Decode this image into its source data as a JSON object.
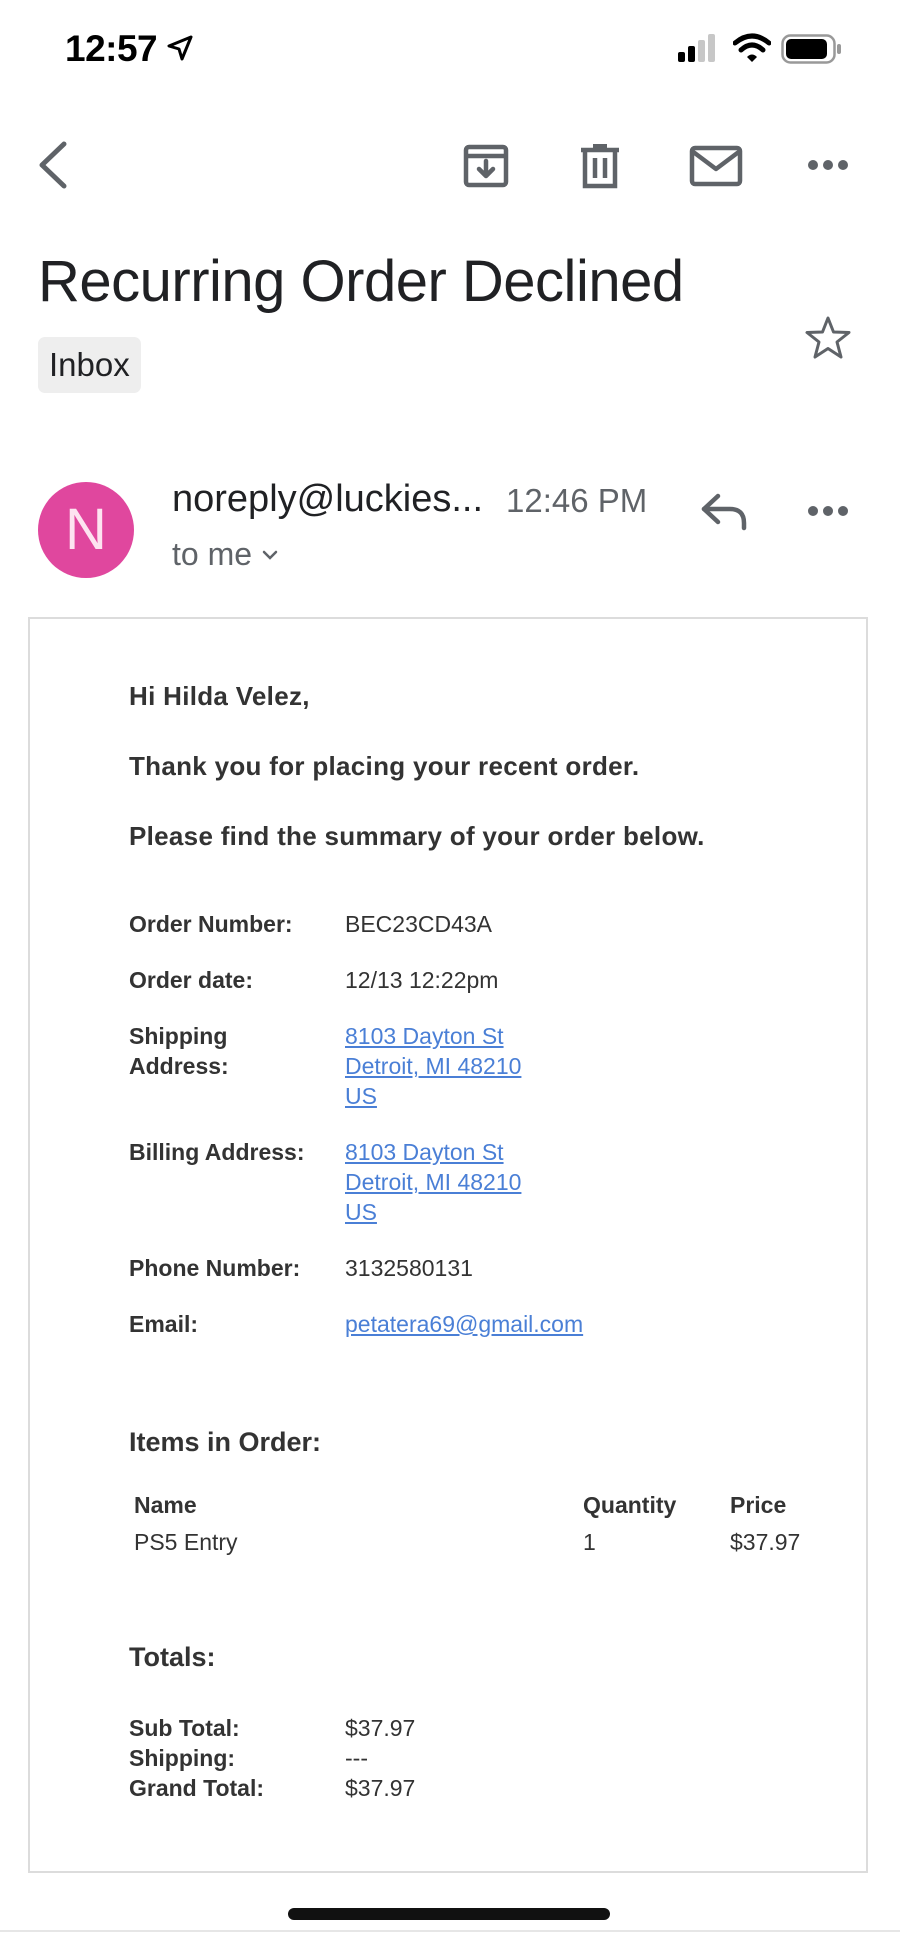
{
  "status_bar": {
    "time": "12:57"
  },
  "email": {
    "subject": "Recurring Order Declined",
    "label": "Inbox",
    "sender_initial": "N",
    "sender": "noreply@luckies...",
    "time": "12:46 PM",
    "recipient": "to me",
    "avatar_color": "#e0479e"
  },
  "body": {
    "greeting": "Hi Hilda Velez,",
    "line1": "Thank you for placing your recent order.",
    "line2": "Please find the summary of your order below.",
    "order_number_label": "Order Number:",
    "order_number": "BEC23CD43A",
    "order_date_label": "Order date:",
    "order_date": "12/13 12:22pm",
    "shipping_label_1": "Shipping",
    "shipping_label_2": "Address:",
    "shipping_address": [
      "8103 Dayton St",
      "Detroit, MI 48210",
      "US"
    ],
    "billing_label": "Billing Address:",
    "billing_address": [
      "8103 Dayton St",
      "Detroit, MI 48210",
      "US"
    ],
    "phone_label": "Phone Number:",
    "phone": "3132580131",
    "email_label": "Email:",
    "email": "petatera69@gmail.com",
    "items_title": "Items in Order:",
    "items_headers": {
      "name": "Name",
      "quantity": "Quantity",
      "price": "Price"
    },
    "items": [
      {
        "name": "PS5 Entry",
        "quantity": "1",
        "price": "$37.97"
      }
    ],
    "totals_title": "Totals:",
    "sub_total_label": "Sub Total:",
    "sub_total": "$37.97",
    "shipping_cost_label": "Shipping:",
    "shipping_cost": "---",
    "grand_total_label": "Grand Total:",
    "grand_total": "$37.97"
  },
  "colors": {
    "link": "#4a7fd6",
    "text": "#333333"
  }
}
